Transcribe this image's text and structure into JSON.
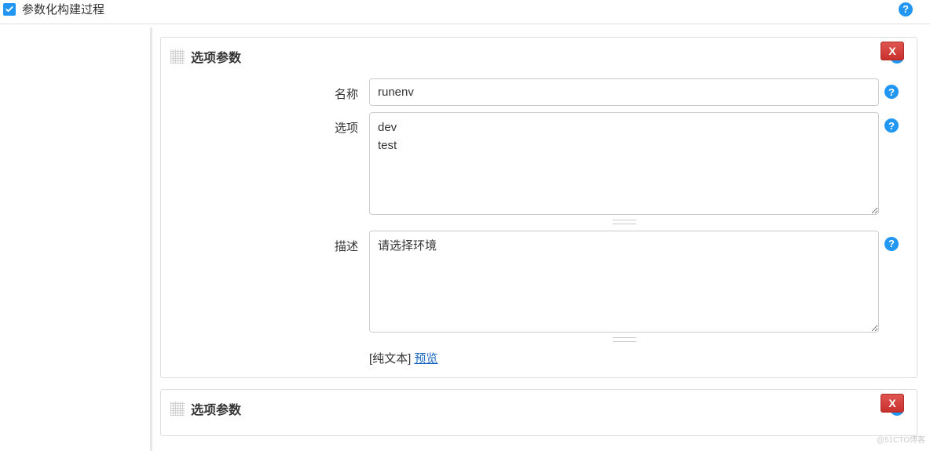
{
  "header": {
    "checkbox_checked": true,
    "label": "参数化构建过程"
  },
  "params": [
    {
      "section_title": "选项参数",
      "close_label": "X",
      "fields": {
        "name_label": "名称",
        "name_value": "runenv",
        "choices_label": "选项",
        "choices_value": "dev\ntest",
        "description_label": "描述",
        "description_value": "请选择环境"
      },
      "hint": {
        "plain_text_label": "[纯文本]",
        "preview_label": "预览"
      }
    },
    {
      "section_title": "选项参数",
      "close_label": "X"
    }
  ],
  "help_glyph": "?",
  "watermark": "@51CTO博客"
}
